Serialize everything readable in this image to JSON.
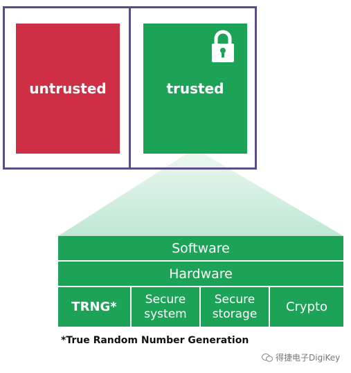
{
  "diagram": {
    "untrusted_label": "untrusted",
    "trusted_label": "trusted",
    "stack": {
      "software": "Software",
      "hardware": "Hardware",
      "cells": {
        "trng": "TRNG*",
        "secure_system": [
          "Secure",
          "system"
        ],
        "secure_storage": [
          "Secure",
          "storage"
        ],
        "crypto": "Crypto"
      }
    },
    "footnote": "*True Random Number Generation"
  },
  "watermark": {
    "text": "得捷电子DigiKey"
  },
  "colors": {
    "frame": "#5b4c86",
    "untrusted": "#cf2f45",
    "trusted": "#1ca358",
    "cone": "#cfeee1"
  },
  "icons": [
    "lock-icon",
    "wechat-icon"
  ]
}
